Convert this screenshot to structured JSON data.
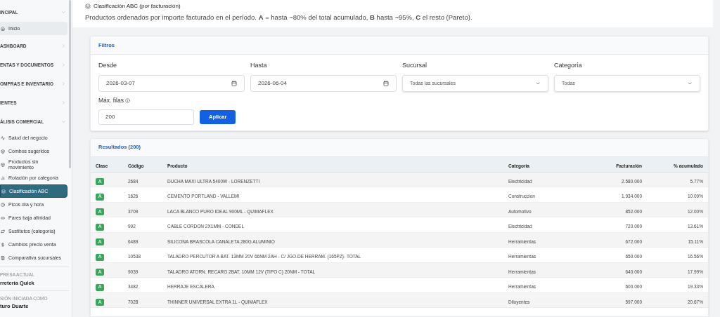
{
  "sidebar": {
    "sections": [
      {
        "label": "INCIPAL",
        "expanded": true,
        "items": [
          {
            "label": "Inicio",
            "selected": false,
            "highlighted": true
          }
        ]
      },
      {
        "label": "ASHBOARD",
        "expanded": false
      },
      {
        "label": "ENTAS Y DOCUMENTOS",
        "expanded": false
      },
      {
        "label": "OMPRAS E INVENTARIO",
        "expanded": false
      },
      {
        "label": "IENTES",
        "expanded": false
      },
      {
        "label": "ÁLISIS COMERCIAL",
        "expanded": true,
        "items": [
          {
            "label": "Salud del negocio",
            "selected": false
          },
          {
            "label": "Combos sugeridos",
            "selected": false
          },
          {
            "label": "Productos sin movimiento",
            "selected": false
          },
          {
            "label": "Rotación por categoría",
            "selected": false
          },
          {
            "label": "Clasificación ABC",
            "selected": true
          },
          {
            "label": "Picos día y hora",
            "selected": false
          },
          {
            "label": "Pares baja afinidad",
            "selected": false
          },
          {
            "label": "Sustitutos (categoría)",
            "selected": false
          },
          {
            "label": "Cambios precio venta",
            "selected": false
          },
          {
            "label": "Comparativa sucursales",
            "selected": false
          }
        ]
      }
    ],
    "company_label": "PRESA ACTUAL",
    "company": "rretería Quick",
    "session_label": "SIÓN INICIADA COMO",
    "user": "turo Duarte"
  },
  "header": {
    "title": "Clasificación ABC (por facturación)",
    "description": "Productos ordenados por importe facturado en el período. **A** = hasta ~80% del total acumulado, **B** hasta ~95%, **C** el resto (Pareto)."
  },
  "filters": {
    "title": "Filtros",
    "desde": {
      "label": "Desde",
      "value": "2026-03-07"
    },
    "hasta": {
      "label": "Hasta",
      "value": "2026-06-04"
    },
    "sucursal": {
      "label": "Sucursal",
      "value": "Todas las sucursales"
    },
    "categoria": {
      "label": "Categoría",
      "value": "Todas"
    },
    "max_rows": {
      "label": "Máx. filas",
      "value": "200"
    },
    "apply": "Aplicar"
  },
  "results": {
    "title": "Resultados (200)",
    "columns": [
      "Clase",
      "Código",
      "Producto",
      "Categoría",
      "Facturación",
      "% acumulado"
    ],
    "rows": [
      [
        "A",
        "2684",
        "DUCHA MAXI ULTRA 5400W - LORENZETTI",
        "Electricidad",
        "2.580.000",
        "5.77%"
      ],
      [
        "A",
        "1626",
        "CEMENTO PORTLAND - VALLEMI",
        "Construccion",
        "1.934.000",
        "10.09%"
      ],
      [
        "A",
        "3709",
        "LACA BLANCO PURO IDEAL 900ML - QUIMAFLEX",
        "Automotivo",
        "852.000",
        "12.00%"
      ],
      [
        "A",
        "992",
        "CABLE CORDON 2X1MM - CONDEL",
        "Electricidad",
        "720.000",
        "13.61%"
      ],
      [
        "A",
        "6489",
        "SILICONA BRASCOLA CANALETA 280G ALUMINIO",
        "Herramientas",
        "672.000",
        "15.11%"
      ],
      [
        "A",
        "10538",
        "TALADRO PERCUTOR A BAT. 13MM 20V 66NM 2AH - C/ JGO.DE HERRAM. (165PZ)- TOTAL",
        "Herramientas",
        "650.000",
        "16.56%"
      ],
      [
        "A",
        "9039",
        "TALADRO ATORN. RECARG 2BAT. 10MM 12V (TIPO C) 20NM - TOTAL",
        "Herramientas",
        "640.000",
        "17.99%"
      ],
      [
        "A",
        "3482",
        "HERRAJE ESCALERA",
        "Herramientas",
        "600.000",
        "19.33%"
      ],
      [
        "A",
        "7028",
        "THINNER UNIVERSAL EXTRA 1L - QUIMAFLEX",
        "Diluyentes",
        "597.000",
        "20.67%"
      ]
    ]
  }
}
